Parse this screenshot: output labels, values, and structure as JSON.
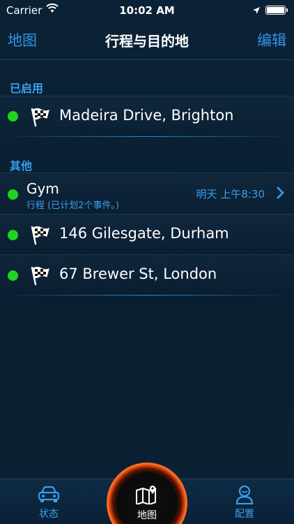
{
  "status_bar": {
    "carrier": "Carrier",
    "time": "10:02 AM"
  },
  "nav": {
    "left": "地图",
    "title": "行程与目的地",
    "right": "编辑"
  },
  "sections": {
    "enabled": {
      "header": "已启用",
      "items": [
        {
          "title": "Madeira Drive, Brighton",
          "icon": "checkered-flag-icon",
          "status_color": "#1fd41f"
        }
      ]
    },
    "other": {
      "header": "其他",
      "trip": {
        "title": "Gym",
        "subtitle": "行程 (已计划2个事件。)",
        "time": "明天 上午8:30"
      },
      "items": [
        {
          "title": "146 Gilesgate, Durham",
          "icon": "checkered-flag-icon"
        },
        {
          "title": "67 Brewer St, London",
          "icon": "checkered-flag-icon"
        }
      ]
    }
  },
  "tabs": {
    "status": "状态",
    "map": "地图",
    "config": "配置"
  },
  "colors": {
    "accent": "#2f96e8",
    "active_dot": "#1fd41f",
    "map_ring": "#e44a10",
    "background": "#0a1e31"
  }
}
